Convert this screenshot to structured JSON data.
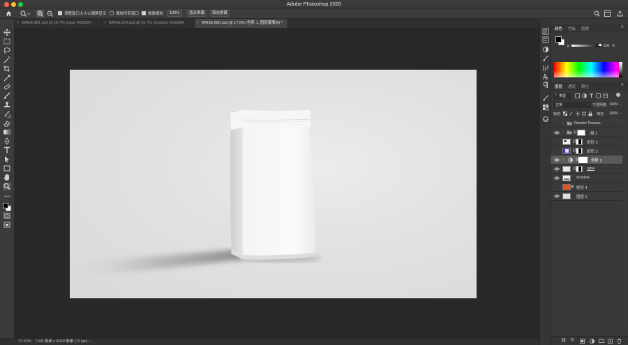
{
  "app": {
    "title": "Adobe Photoshop 2020",
    "traffic_lights": [
      "#fe5f57",
      "#febc2e",
      "#28c840"
    ]
  },
  "options_bar": {
    "resize_windows_label": "调整窗口大小以满屏显示",
    "resize_windows_checked": true,
    "zoom_all_label": "缩放所有窗口",
    "zoom_all_checked": false,
    "scrubby_zoom_label": "细微缩放",
    "scrubby_zoom_checked": true,
    "zoom_value": "100%",
    "fit_screen_label": "适合屏幕",
    "fill_screen_label": "填充屏幕"
  },
  "tabs": [
    {
      "close": "×",
      "label": "BAISE.881.psd @ 16.7% (rgba, RGB/8#)"
    },
    {
      "close": "×",
      "label": "BAISE.879.psd @ 16.7% (shadow, RGB/8#)"
    },
    {
      "close": "×",
      "label": "BAISE.880.psd @ 17.5% (色阶 1, 图层蒙版/8) *"
    }
  ],
  "status_bar": {
    "zoom": "17.52%",
    "doc_info": "7108 像素 x 4000 像素 (72 ppi)",
    "arrow": "›"
  },
  "color_panel": {
    "tabs": [
      "颜色",
      "色板",
      "图案"
    ],
    "k_label": "K",
    "k_value": "100",
    "unit": "%"
  },
  "layers_panel": {
    "tabs": [
      "图层",
      "通道",
      "路径"
    ],
    "kind_filter": "类型",
    "blend_mode": "正常",
    "opacity_label": "不透明度:",
    "opacity_value": "100%",
    "lock_label": "锁定:",
    "fill_label": "填充:",
    "fill_value": "100%",
    "layers": [
      {
        "name": "Render Passes",
        "visible": false,
        "type": "group"
      },
      {
        "name": "组 1",
        "visible": true,
        "type": "group"
      },
      {
        "name": "矩形 2",
        "visible": false,
        "type": "shape"
      },
      {
        "name": "矩形 3",
        "visible": false,
        "type": "shape"
      },
      {
        "name": "色阶 1",
        "visible": true,
        "type": "adjustment",
        "selected": true
      },
      {
        "name": "rgba",
        "visible": true,
        "type": "pixel"
      },
      {
        "name": "shadow",
        "visible": true,
        "type": "pixel"
      },
      {
        "name": "矩形 4",
        "visible": false,
        "type": "shape"
      },
      {
        "name": "图层 1",
        "visible": true,
        "type": "pixel"
      }
    ]
  },
  "colors": {
    "accent_orange": "#e8511f",
    "swatch_blue": "#3a2fd6"
  }
}
